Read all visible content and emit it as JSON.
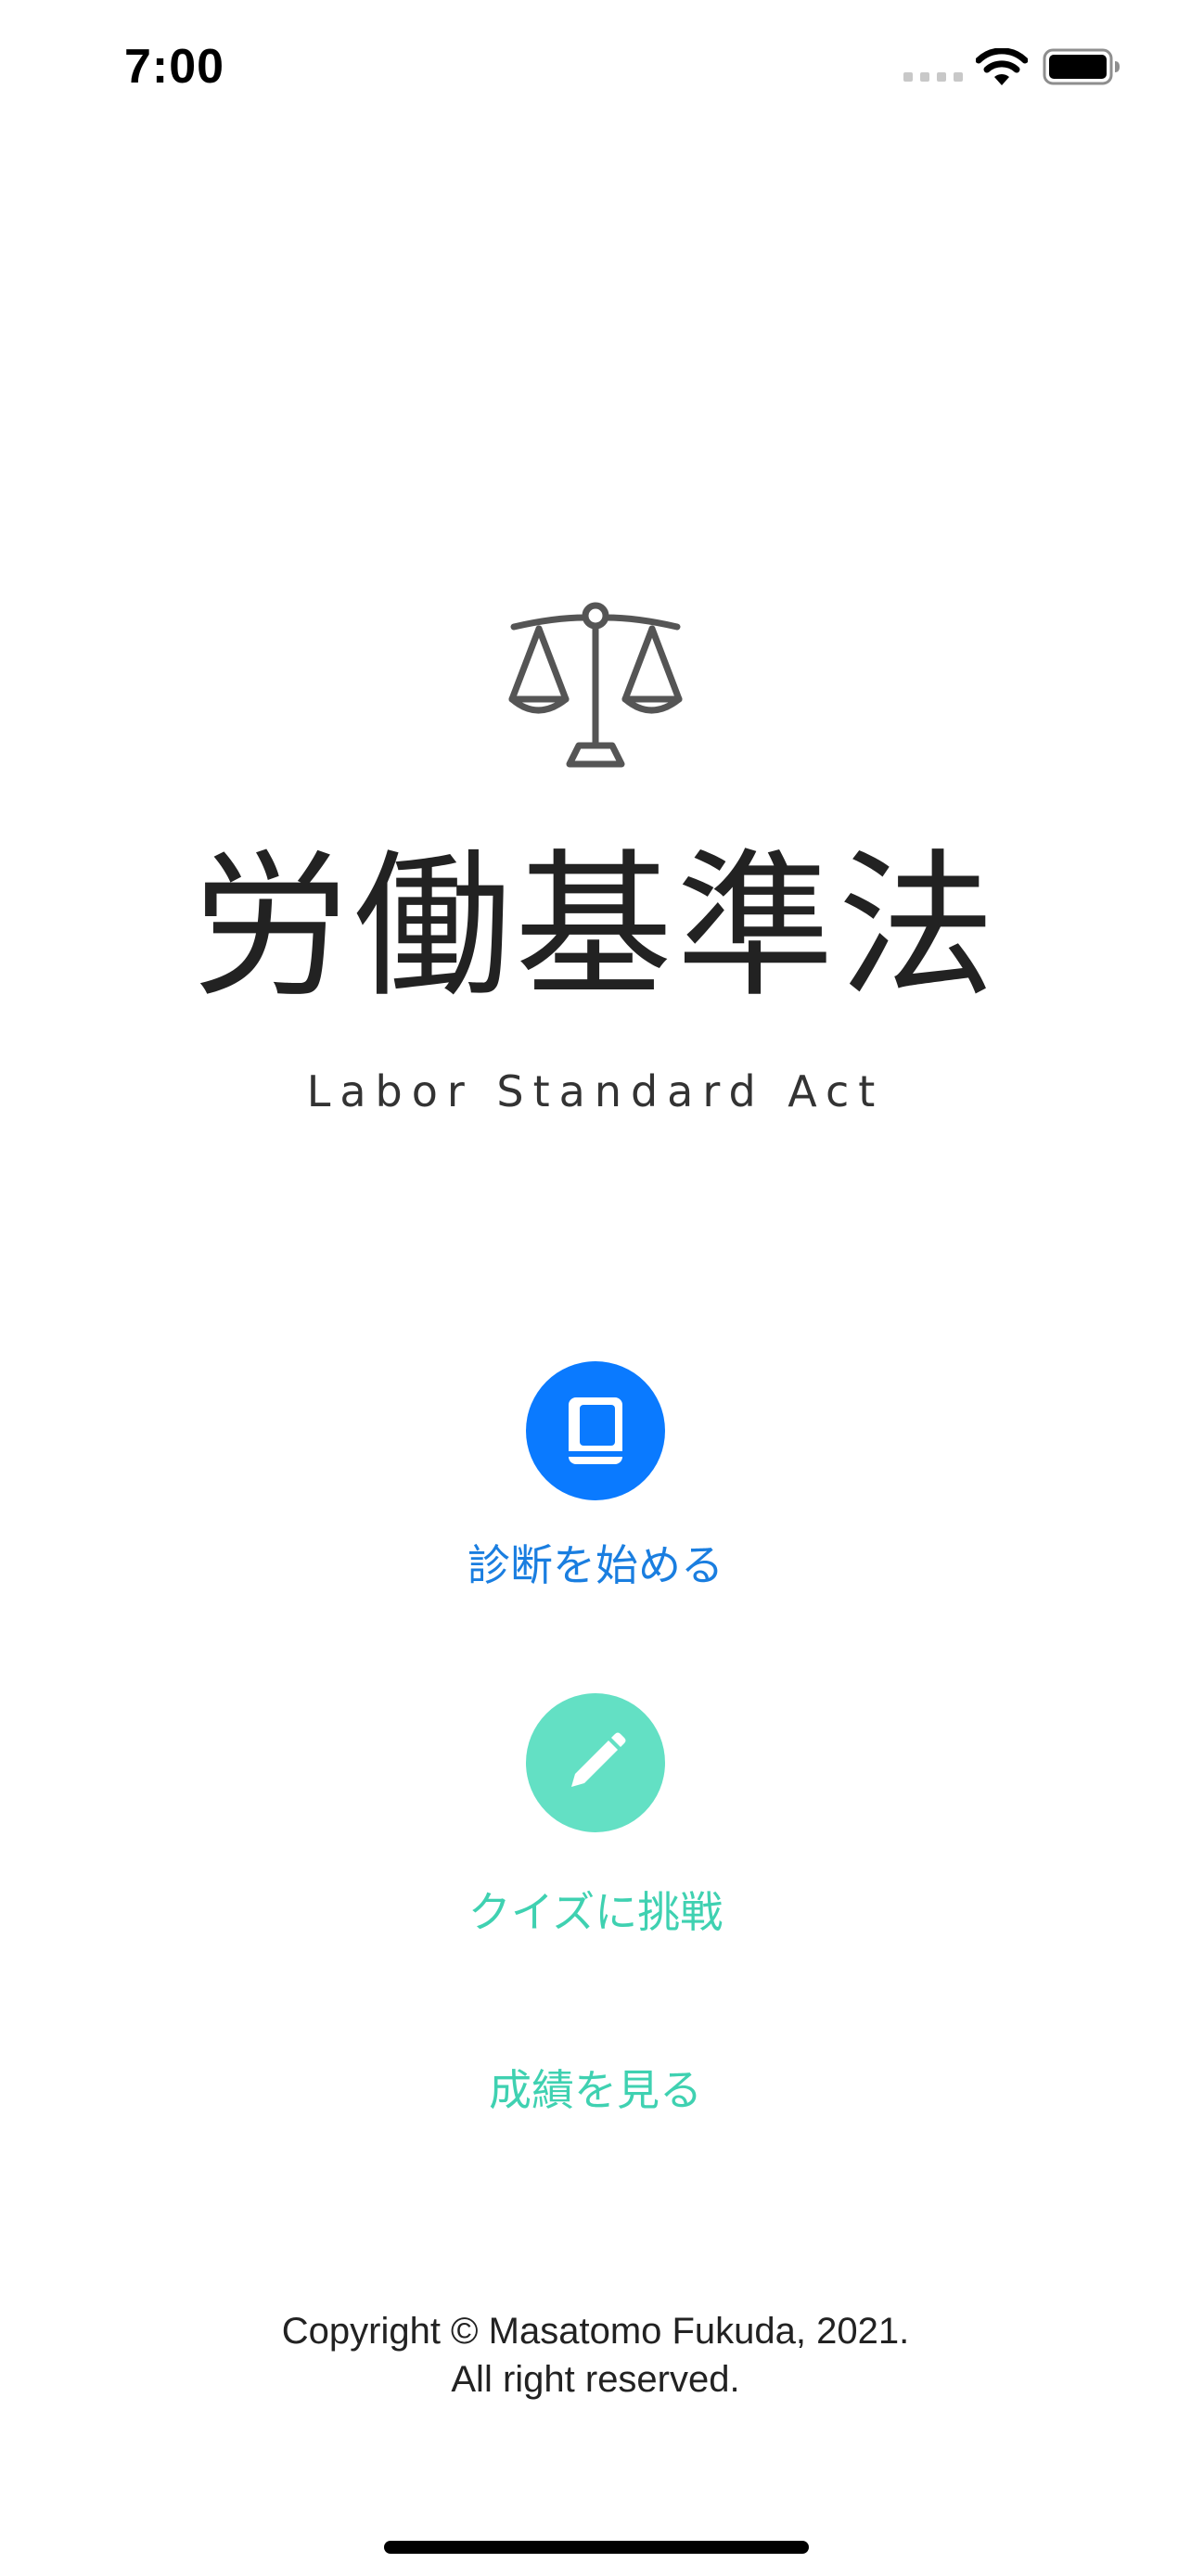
{
  "status_bar": {
    "time": "7:00"
  },
  "logo": {
    "icon": "scales-icon",
    "title": "労働基準法",
    "subtitle": "Labor Standard Act"
  },
  "actions": {
    "diagnosis": {
      "icon": "book-icon",
      "label": "診断を始める",
      "color": "#0a7aff"
    },
    "quiz": {
      "icon": "pencil-icon",
      "label": "クイズに挑戦",
      "color": "#63e0c4"
    },
    "results": {
      "label": "成績を見る"
    }
  },
  "footer": {
    "copyright_line1": "Copyright © Masatomo Fukuda, 2021.",
    "copyright_line2": "All right reserved."
  }
}
